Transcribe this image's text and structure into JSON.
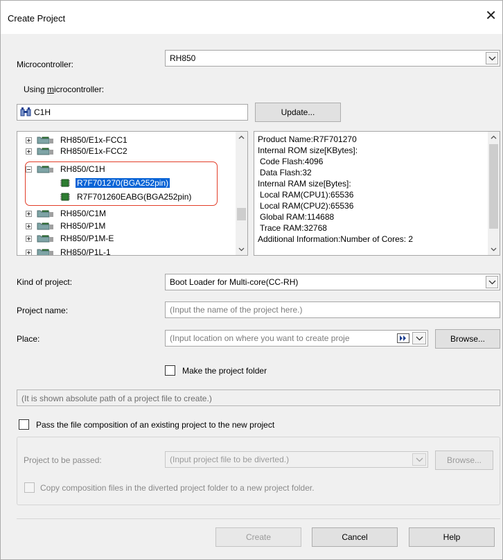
{
  "window": {
    "title": "Create Project"
  },
  "microcontroller": {
    "label": "Microcontroller:",
    "value": "RH850"
  },
  "using_mcu": {
    "label_prefix": "Using ",
    "label_underlined": "m",
    "label_suffix": "icrocontroller:"
  },
  "search": {
    "value": "C1H",
    "update_label": "Update..."
  },
  "tree": {
    "items": [
      {
        "label": "RH850/E1x-FCC1",
        "level": 0,
        "type": "group",
        "expander": "+"
      },
      {
        "label": "RH850/E1x-FCC2",
        "level": 0,
        "type": "group",
        "expander": "+"
      },
      {
        "label": "RH850/C1H",
        "level": 0,
        "type": "group",
        "expander": "-"
      },
      {
        "label": "R7F701270(BGA252pin)",
        "level": 1,
        "type": "device",
        "selected": true
      },
      {
        "label": "R7F701260EABG(BGA252pin)",
        "level": 1,
        "type": "device"
      },
      {
        "label": "RH850/C1M",
        "level": 0,
        "type": "group",
        "expander": "+"
      },
      {
        "label": "RH850/P1M",
        "level": 0,
        "type": "group",
        "expander": "+"
      },
      {
        "label": "RH850/P1M-E",
        "level": 0,
        "type": "group",
        "expander": "+"
      },
      {
        "label": "RH850/P1L-1",
        "level": 0,
        "type": "group",
        "expander": "+"
      }
    ]
  },
  "info": {
    "lines": [
      "Product Name:R7F701270",
      "Internal ROM size[KBytes]:",
      "  Code Flash:4096",
      "  Data Flash:32",
      "Internal RAM size[Bytes]:",
      "  Local RAM(CPU1):65536",
      "  Local RAM(CPU2):65536",
      "  Global RAM:114688",
      "  Trace RAM:32768",
      "Additional Information:Number of Cores: 2"
    ]
  },
  "kind": {
    "label": "Kind of project:",
    "value": "Boot Loader for Multi-core(CC-RH)"
  },
  "project_name": {
    "label": "Project name:",
    "placeholder": "(Input the name of the project here.)"
  },
  "place": {
    "label": "Place:",
    "placeholder": "(Input location on where you want to create proje",
    "browse_label": "Browse..."
  },
  "make_folder": {
    "label": "Make the project folder",
    "checked": false
  },
  "path_display": {
    "text": "(It is shown absolute path of a project file to create.)"
  },
  "pass_files": {
    "label": "Pass the file composition of an existing project to the new project",
    "checked": false
  },
  "project_passed": {
    "label": "Project to be passed:",
    "placeholder": "(Input project file to be diverted.)",
    "browse_label": "Browse..."
  },
  "copy_composition": {
    "label": "Copy composition files in the diverted project folder to a new project folder."
  },
  "buttons": {
    "create": "Create",
    "cancel": "Cancel",
    "help": "Help"
  },
  "colors": {
    "selection": "#0a64d6",
    "highlight_border": "#e23d28",
    "dialog_bg": "#f0f0f0"
  }
}
